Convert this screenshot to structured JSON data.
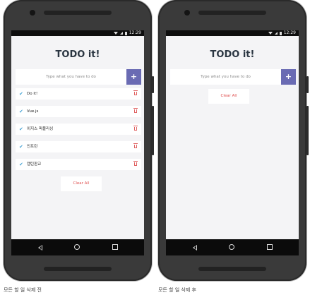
{
  "colors": {
    "accent": "#6a6bb3",
    "check": "#4aa6d6",
    "danger": "#e05050",
    "screen_bg": "#f4f4f6"
  },
  "before": {
    "status_time": "12:29",
    "app_title": "TODO it!",
    "input_placeholder": "Type what you have to do",
    "add_label": "+",
    "items": [
      {
        "label": "Do it!",
        "icon": "check-icon"
      },
      {
        "label": "Vue.js",
        "icon": "check-icon"
      },
      {
        "label": "이지스 퍼블리싱",
        "icon": "check-icon"
      },
      {
        "label": "인프런",
        "icon": "check-icon"
      },
      {
        "label": "캡틴판교",
        "icon": "check-icon"
      }
    ],
    "clear_all_label": "Clear All",
    "caption": "모든 할 일 삭제 전"
  },
  "after": {
    "status_time": "12:29",
    "app_title": "TODO it!",
    "input_placeholder": "Type what you have to do",
    "add_label": "+",
    "items": [],
    "clear_all_label": "Clear All",
    "caption": "모든 할 일 삭제 후"
  }
}
